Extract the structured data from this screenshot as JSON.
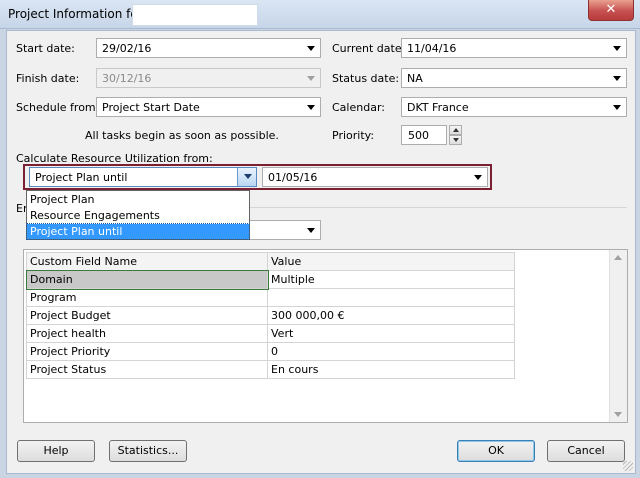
{
  "window": {
    "title": "Project Information for",
    "close_label": "✕"
  },
  "form": {
    "start_date_label": "Start date:",
    "start_date_value": "29/02/16",
    "finish_date_label": "Finish date:",
    "finish_date_value": "30/12/16",
    "schedule_from_label": "Schedule from:",
    "schedule_from_value": "Project Start Date",
    "schedule_note": "All tasks begin as soon as possible.",
    "current_date_label": "Current date:",
    "current_date_value": "11/04/16",
    "status_date_label": "Status date:",
    "status_date_value": "NA",
    "calendar_label": "Calendar:",
    "calendar_value": "DKT France",
    "priority_label": "Priority:",
    "priority_value": "500"
  },
  "resource_util": {
    "label": "Calculate Resource Utilization from:",
    "mode_value": "Project Plan until",
    "date_value": "01/05/16",
    "options": [
      "Project Plan",
      "Resource Engagements",
      "Project Plan until"
    ],
    "selected_index": 2
  },
  "enterprise": {
    "label_partial": "En"
  },
  "custom_fields": {
    "headers": [
      "Custom Field Name",
      "Value"
    ],
    "rows": [
      {
        "name": "Domain",
        "value": "Multiple"
      },
      {
        "name": "Program",
        "value": ""
      },
      {
        "name": "Project Budget",
        "value": "300 000,00 €"
      },
      {
        "name": "Project health",
        "value": "Vert"
      },
      {
        "name": "Project Priority",
        "value": "0"
      },
      {
        "name": "Project Status",
        "value": "En cours"
      }
    ]
  },
  "buttons": {
    "help": "Help",
    "statistics": "Statistics...",
    "ok": "OK",
    "cancel": "Cancel"
  },
  "colors": {
    "highlight_frame": "#7b1f33",
    "selection": "#3399ff"
  }
}
